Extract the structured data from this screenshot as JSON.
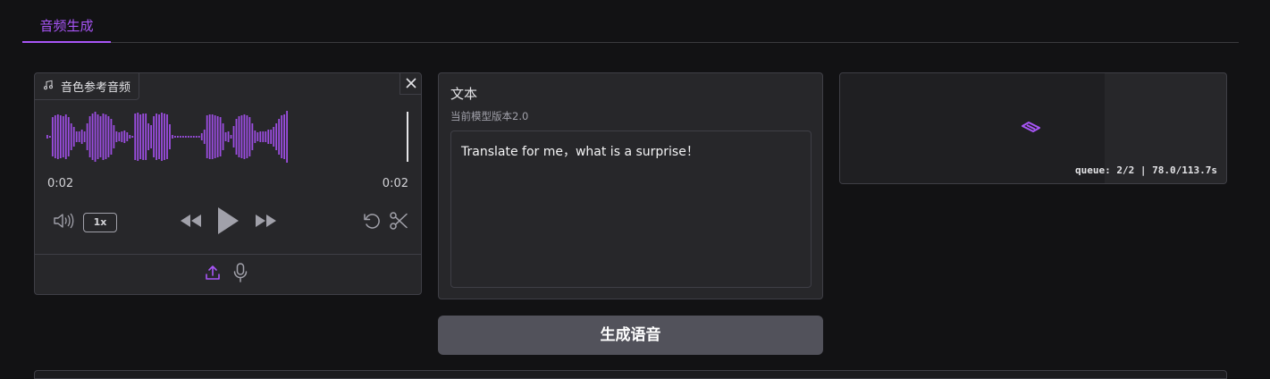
{
  "tabs": [
    {
      "label": "音频生成",
      "active": true
    }
  ],
  "audio": {
    "label": "音色参考音频",
    "current_time": "0:02",
    "duration": "0:02",
    "playback_rate": "1x",
    "waveform_color": "#9b4de0"
  },
  "text_field": {
    "label": "文本",
    "info": "当前模型版本2.0",
    "value": "Translate for me，what is a surprise！"
  },
  "generate_button": {
    "label": "生成语音"
  },
  "output": {
    "queue_status": "queue: 2/2 | 78.0/113.7s",
    "progress": 0.686
  },
  "colors": {
    "accent": "#a855f7",
    "panel": "#27272a",
    "background": "#121214"
  }
}
